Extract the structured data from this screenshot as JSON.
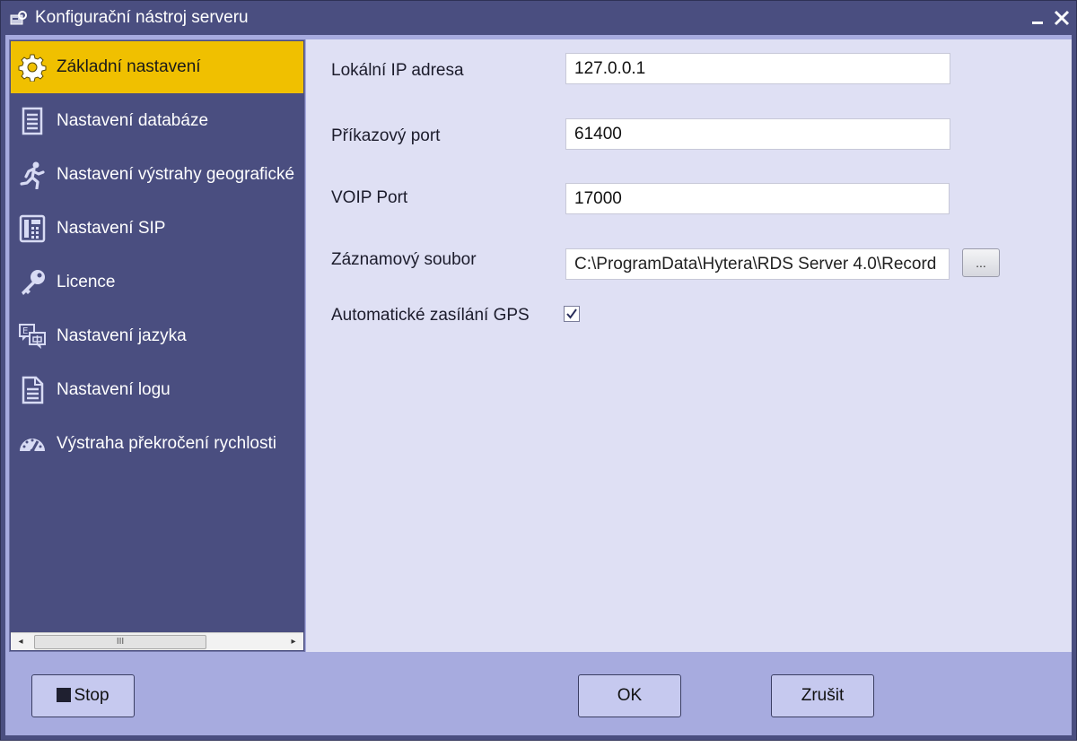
{
  "window": {
    "title": "Konfigurační nástroj serveru",
    "minimize_label": "_",
    "close_label": "✕"
  },
  "sidebar": {
    "items": [
      {
        "label": "Základní nastavení",
        "icon": "gear-icon",
        "active": true
      },
      {
        "label": "Nastavení databáze",
        "icon": "database-icon",
        "active": false
      },
      {
        "label": "Nastavení výstrahy geografické",
        "icon": "running-person-icon",
        "active": false
      },
      {
        "label": "Nastavení SIP",
        "icon": "phone-icon",
        "active": false
      },
      {
        "label": "Licence",
        "icon": "key-icon",
        "active": false
      },
      {
        "label": "Nastavení jazyka",
        "icon": "language-icon",
        "active": false
      },
      {
        "label": "Nastavení logu",
        "icon": "document-icon",
        "active": false
      },
      {
        "label": "Výstraha překročení rychlosti",
        "icon": "speedometer-icon",
        "active": false
      }
    ],
    "scrollbar": {
      "left_arrow": "◂",
      "right_arrow": "▸",
      "thumb_grip": "III"
    }
  },
  "form": {
    "local_ip": {
      "label": "Lokální IP adresa",
      "value": "127.0.0.1"
    },
    "command_port": {
      "label": "Příkazový port",
      "value": "61400"
    },
    "voip_port": {
      "label": "VOIP Port",
      "value": "17000"
    },
    "record_file": {
      "label": "Záznamový soubor",
      "value": "C:\\ProgramData\\Hytera\\RDS Server 4.0\\Record",
      "browse_label": "..."
    },
    "auto_gps": {
      "label": "Automatické zasílání GPS",
      "checked": true,
      "check_mark": "✓"
    }
  },
  "footer": {
    "stop_label": "Stop",
    "ok_label": "OK",
    "cancel_label": "Zrušit"
  },
  "colors": {
    "titlebar": "#4a4e80",
    "sidebar": "#4a4e80",
    "active_item": "#f0c000",
    "content": "#dfe0f4",
    "frame": "#a7abdf",
    "button": "#c6c9ef"
  }
}
